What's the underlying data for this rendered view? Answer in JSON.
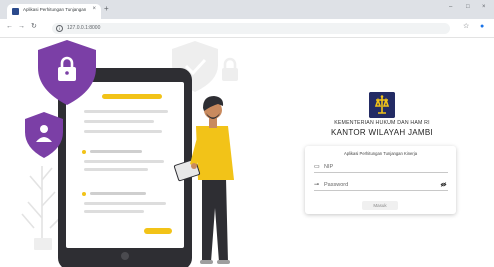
{
  "browser": {
    "tab_title": "Aplikasi Perhitungan Tunjangan",
    "tab_close": "×",
    "new_tab": "+",
    "url": "127.0.0.1:8000",
    "nav": {
      "back": "←",
      "forward": "→",
      "reload": "↻"
    },
    "window": {
      "minimize": "–",
      "maximize": "□",
      "close": "×"
    },
    "toolbar_icons": {
      "bookmark": "☆",
      "profile": "●"
    }
  },
  "header": {
    "org_line1": "KEMENTERIAN HUKUM DAN HAM RI",
    "org_line2": "KANTOR WILAYAH JAMBI"
  },
  "login": {
    "title": "Aplikasi Perhitungan Tunjangan Kinerja",
    "nip": {
      "icon": "id-card-icon",
      "placeholder": "NIP",
      "value": ""
    },
    "password": {
      "icon": "key-icon",
      "placeholder": "Password",
      "value": ""
    },
    "submit_label": "Masuk"
  },
  "colors": {
    "shield_purple": "#7b3fa6",
    "accent_yellow": "#f2c318",
    "logo_navy": "#232b64",
    "phone_frame": "#2e2e33"
  }
}
